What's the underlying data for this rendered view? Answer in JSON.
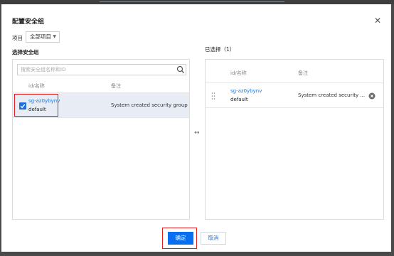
{
  "dialog": {
    "title": "配置安全组",
    "close_glyph": "✕"
  },
  "project": {
    "label": "项目",
    "selected": "全部项目",
    "caret_glyph": "▼"
  },
  "left": {
    "title": "选择安全组",
    "search_placeholder": "搜索安全组名称和ID",
    "columns": [
      "id/名称",
      "备注"
    ],
    "rows": [
      {
        "id": "sg-az0ybynv",
        "name": "default",
        "note": "System created security group",
        "checked": true
      }
    ]
  },
  "right": {
    "title": "已选择（1）",
    "columns": [
      "id/名称",
      "备注"
    ],
    "rows": [
      {
        "id": "sg-az0ybynv",
        "name": "default",
        "note": "System created security ..."
      }
    ]
  },
  "transfer_glyph": "↔",
  "buttons": {
    "ok": "确定",
    "cancel": "取消"
  },
  "colors": {
    "primary": "#0a6ef0",
    "link": "#1a73d8",
    "highlight": "#e01e1e"
  }
}
